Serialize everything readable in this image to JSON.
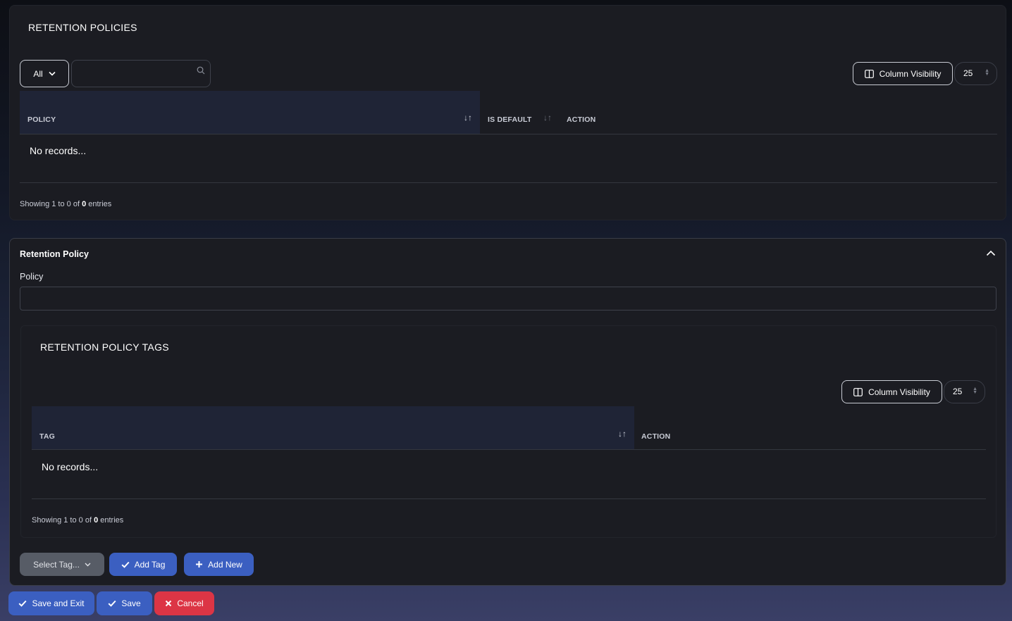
{
  "policies": {
    "title": "RETENTION POLICIES",
    "filter_value": "All",
    "search_placeholder": "",
    "column_visibility_label": "Column Visibility",
    "page_size": "25",
    "columns": [
      "POLICY",
      "IS DEFAULT",
      "ACTION"
    ],
    "empty_text": "No records...",
    "footer": {
      "prefix": "Showing 1 to 0 of",
      "total": "0",
      "suffix": "entries"
    }
  },
  "form": {
    "title": "Retention Policy",
    "policy_label": "Policy",
    "policy_value": ""
  },
  "tags": {
    "title": "RETENTION POLICY TAGS",
    "column_visibility_label": "Column Visibility",
    "page_size": "25",
    "columns": [
      "TAG",
      "ACTION"
    ],
    "empty_text": "No records...",
    "footer": {
      "prefix": "Showing 1 to 0 of",
      "total": "0",
      "suffix": "entries"
    },
    "select_tag_placeholder": "Select Tag...",
    "add_tag_label": "Add Tag",
    "add_new_label": "Add New"
  },
  "actions": {
    "save_exit_label": "Save and Exit",
    "save_label": "Save",
    "cancel_label": "Cancel"
  },
  "colors": {
    "primary": "#3b5fc1",
    "danger": "#dc3545",
    "header_bg": "#1f2436"
  }
}
